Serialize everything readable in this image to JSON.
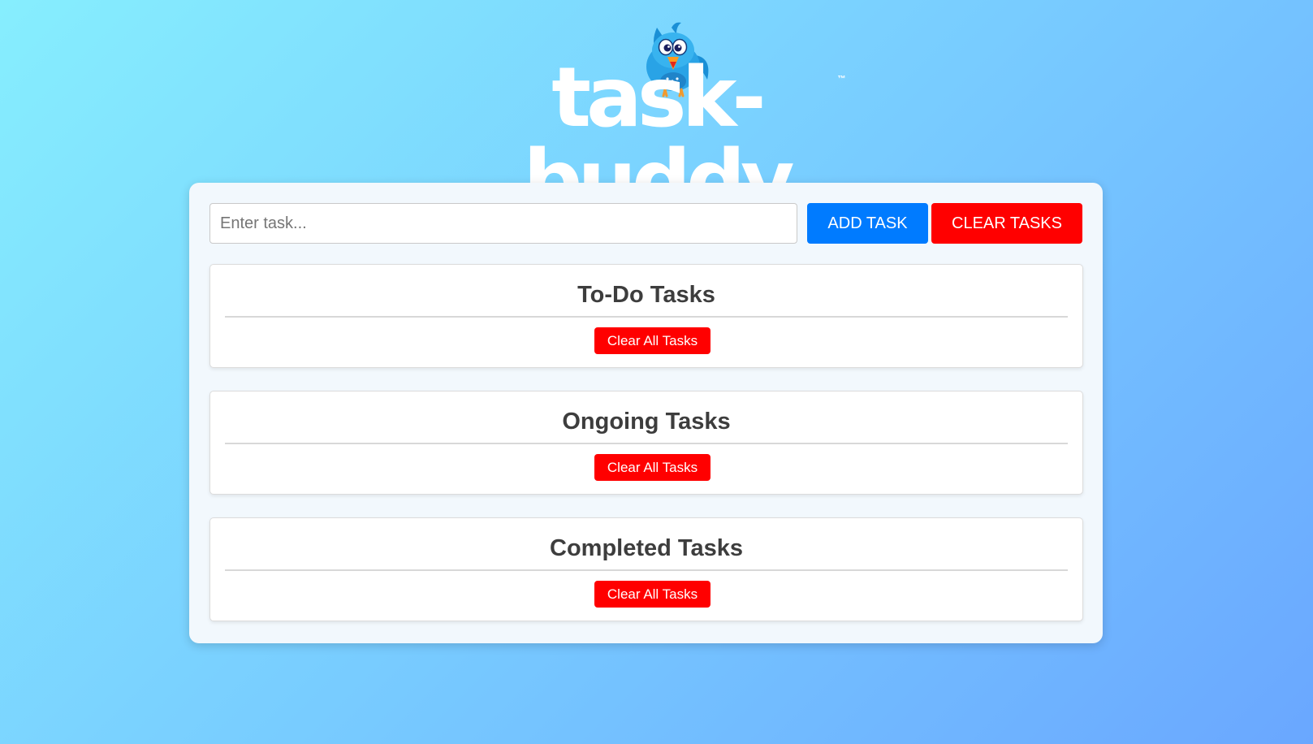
{
  "brand": {
    "logo_text": "task-buddy",
    "trademark": "™",
    "mascot_icon": "bird-mascot-icon"
  },
  "toolbar": {
    "input_placeholder": "Enter task...",
    "input_value": "",
    "add_label": "ADD TASK",
    "clear_label": "CLEAR TASKS"
  },
  "sections": [
    {
      "title": "To-Do Tasks",
      "clear_label": "Clear All Tasks"
    },
    {
      "title": "Ongoing Tasks",
      "clear_label": "Clear All Tasks"
    },
    {
      "title": "Completed Tasks",
      "clear_label": "Clear All Tasks"
    }
  ],
  "colors": {
    "primary_blue": "#007bff",
    "danger_red": "#ff0000",
    "heading": "#3d3d3d",
    "card_bg": "#f2f8fd"
  }
}
